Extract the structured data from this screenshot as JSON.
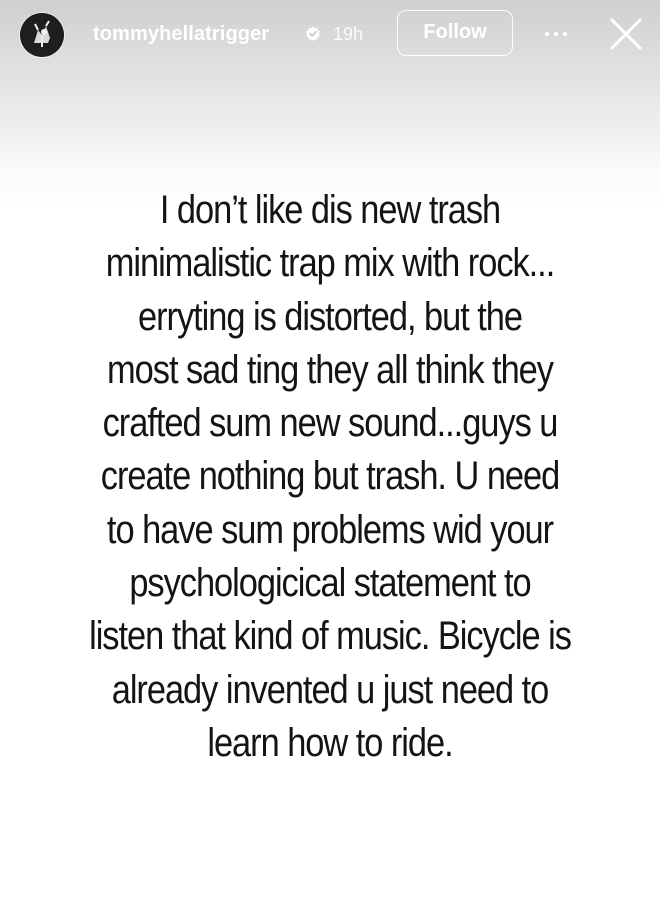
{
  "header": {
    "username": "tommyhellatrigger",
    "verified_icon": "verified-badge-icon",
    "timestamp": "19h",
    "follow_label": "Follow",
    "more_icon": "more-dots-icon",
    "close_icon": "close-icon",
    "avatar_icon": "avatar-image"
  },
  "story": {
    "text": "I don’t like dis new trash\nminimalistic trap mix with rock...\nerryting is distorted, but the\nmost sad ting they all think they\ncrafted sum new sound...guys u\ncreate nothing but trash. U need\nto have sum problems wid your\npsychologicical statement to\nlisten that kind of music. Bicycle is\nalready invented u just need to\nlearn how to ride.",
    "background_color": "#ffffff",
    "text_color": "#141414"
  }
}
